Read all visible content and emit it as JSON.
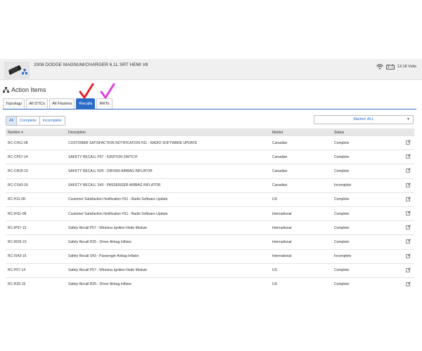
{
  "header": {
    "vehicle": "2008 DODGE MAGNUM/CHARGER 6.1L SRT HEMI V8",
    "voltage": "13.18 Volts"
  },
  "section": {
    "title": "Action Items"
  },
  "tabs": [
    {
      "label": "Topology",
      "active": false
    },
    {
      "label": "All DTCs",
      "active": false
    },
    {
      "label": "All Flashes",
      "active": false
    },
    {
      "label": "Recalls",
      "active": true
    },
    {
      "label": "RRTs",
      "active": false
    }
  ],
  "filters": [
    {
      "label": "All",
      "active": true
    },
    {
      "label": "Complete",
      "active": false
    },
    {
      "label": "Incomplete",
      "active": false
    }
  ],
  "market_select": {
    "value": "Market: ALL"
  },
  "table": {
    "headers": {
      "number": "Number ▾",
      "description": "Description",
      "market": "Market",
      "status": "Status"
    },
    "rows": [
      {
        "number": "RC-CH11-08",
        "description": "CUSTOMER SATISFACTION NOTIFICATION H11 - RADIO SOFTWARE UPDATE",
        "market": "Canadian",
        "status": "Complete"
      },
      {
        "number": "RC-CP57-14",
        "description": "SAFETY RECALL P57 - IGNITION SWITCH",
        "market": "Canadian",
        "status": "Complete"
      },
      {
        "number": "RC-CR25-15",
        "description": "SAFETY RECALL R25 - DRIVER AIRBAG INFLATOR",
        "market": "Canadian",
        "status": "Complete"
      },
      {
        "number": "RC-CS43-16",
        "description": "SAFETY RECALL S43 - PASSENGER AIRBAG INFLATOR",
        "market": "Canadian",
        "status": "Incomplete"
      },
      {
        "number": "RC-H11-08",
        "description": "Customer Satisfaction Notification H11 - Radio Software Update",
        "market": "US",
        "status": "Complete"
      },
      {
        "number": "RC-IH11-08",
        "description": "Customer Satisfaction Notification H11 - Radio Software Update",
        "market": "International",
        "status": "Complete"
      },
      {
        "number": "RC-IP57-15",
        "description": "Safety Recall P57 - Wireless Ignition Node Module",
        "market": "International",
        "status": "Complete"
      },
      {
        "number": "RC-IR25-15",
        "description": "Safety Recall R25 - Driver Airbag Inflator",
        "market": "International",
        "status": "Complete"
      },
      {
        "number": "RC-IS43-16",
        "description": "Safety Recall S43 - Passenger Airbag Inflator",
        "market": "International",
        "status": "Incomplete"
      },
      {
        "number": "RC-P57-14",
        "description": "Safety Recall P57 - Wireless Ignition Node Module",
        "market": "US",
        "status": "Complete"
      },
      {
        "number": "RC-R25-15",
        "description": "Safety Recall R25 - Driver Airbag Inflator",
        "market": "US",
        "status": "Complete"
      }
    ]
  },
  "colors": {
    "accent": "#2c6cc7",
    "check_red": "#e8202a",
    "check_magenta": "#e040e0"
  },
  "icons": [
    "car-logo-icon",
    "wifi-icon",
    "battery-icon",
    "hierarchy-icon",
    "edit-icon",
    "check-mark-icon"
  ]
}
